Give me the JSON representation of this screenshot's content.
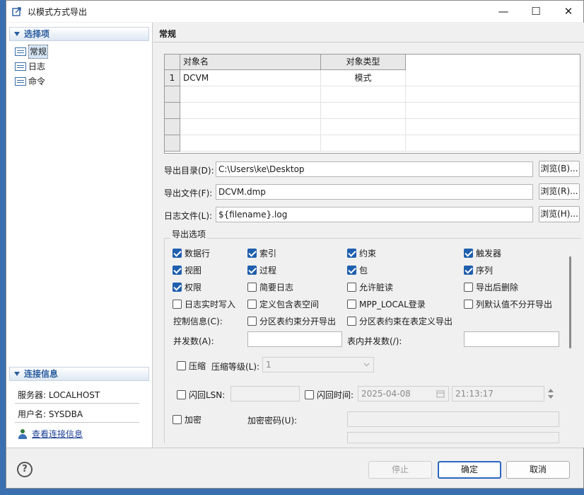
{
  "window": {
    "title": "以模式方式导出",
    "min_glyph": "—",
    "max_glyph": "☐",
    "close_glyph": "✕"
  },
  "left": {
    "select_header": "选择项",
    "items": [
      {
        "label": "常规"
      },
      {
        "label": "日志"
      },
      {
        "label": "命令"
      }
    ],
    "conn_header": "连接信息",
    "server": "服务器: LOCALHOST",
    "user": "用户名: SYSDBA",
    "view_conn": "查看连接信息"
  },
  "main": {
    "title": "常规",
    "grid": {
      "columns": [
        "对象名",
        "对象类型"
      ],
      "rows": [
        {
          "num": "1",
          "name": "DCVM",
          "type": "模式"
        }
      ]
    },
    "export_dir": {
      "label": "导出目录(D):",
      "value": "C:\\Users\\ke\\Desktop",
      "browse": "浏览(B)..."
    },
    "export_file": {
      "label": "导出文件(F):",
      "value": "DCVM.dmp",
      "browse": "浏览(R)..."
    },
    "log_file": {
      "label": "日志文件(L):",
      "value": "${filename}.log",
      "browse": "浏览(H)..."
    },
    "options": {
      "label": "导出选项",
      "row1": [
        {
          "label": "数据行",
          "checked": true
        },
        {
          "label": "索引",
          "checked": true
        },
        {
          "label": "约束",
          "checked": true
        },
        {
          "label": "触发器",
          "checked": true
        }
      ],
      "row2": [
        {
          "label": "视图",
          "checked": true
        },
        {
          "label": "过程",
          "checked": true
        },
        {
          "label": "包",
          "checked": true
        },
        {
          "label": "序列",
          "checked": true
        }
      ],
      "row3": [
        {
          "label": "权限",
          "checked": true
        },
        {
          "label": "简要日志",
          "checked": false
        },
        {
          "label": "允许脏读",
          "checked": false
        },
        {
          "label": "导出后删除",
          "checked": false
        }
      ],
      "row4": [
        {
          "label": "日志实时写入",
          "checked": false
        },
        {
          "label": "定义包含表空间",
          "checked": false
        },
        {
          "label": "MPP_LOCAL登录",
          "checked": false
        },
        {
          "label": "列默认值不分开导出",
          "checked": false
        }
      ],
      "control_info": "控制信息(C):",
      "row5": [
        {
          "label": "分区表约束分开导出",
          "checked": false
        },
        {
          "label": "分区表约束在表定义导出",
          "checked": false
        }
      ],
      "concurrency": "并发数(A):",
      "table_concurrency": "表内并发数(/):",
      "compress": "压缩",
      "compress_level": "压缩等级(L):",
      "compress_level_value": "1",
      "flashback_lsn": "闪回LSN:",
      "flashback_time": "闪回时间:",
      "date_value": "2025-04-08",
      "time_value": "21:13:17",
      "encrypt": "加密",
      "encrypt_password": "加密密码(U):"
    }
  },
  "footer": {
    "help": "?",
    "stop": "停止",
    "ok": "确定",
    "cancel": "取消"
  }
}
